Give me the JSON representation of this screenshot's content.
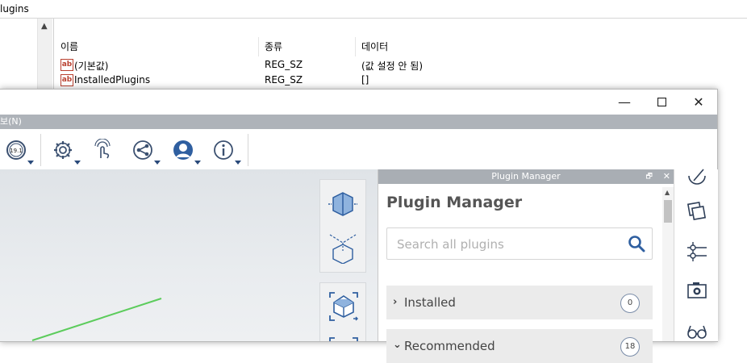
{
  "registry": {
    "address": "lugins",
    "columns": [
      "이름",
      "종류",
      "데이터"
    ],
    "rows": [
      {
        "name": "(기본값)",
        "type": "REG_SZ",
        "data": "(값 설정 안 됨)"
      },
      {
        "name": "InstalledPlugins",
        "type": "REG_SZ",
        "data": "[]"
      }
    ],
    "value_icon": "ab"
  },
  "app": {
    "window_buttons": {
      "minimize": "—",
      "maximize": "☐",
      "close": "✕"
    },
    "menu": {
      "partial_item": "보(N)"
    },
    "toolbar_icons": [
      "version-badge-icon",
      "settings-icon",
      "touch-hand-icon",
      "share-icon",
      "account-icon",
      "info-icon"
    ],
    "version_badge": "19.1"
  },
  "plugin_manager": {
    "panel_title": "Plugin Manager",
    "heading": "Plugin Manager",
    "search": {
      "placeholder": "Search all plugins",
      "value": ""
    },
    "sections": [
      {
        "label": "Installed",
        "count": "0",
        "expanded": false
      },
      {
        "label": "Recommended",
        "count": "18",
        "expanded": true
      }
    ],
    "header_buttons": {
      "float": "🗗",
      "close": "✕"
    }
  },
  "right_strip_icons": [
    "sketch-icon",
    "layers-icon",
    "align-icon",
    "camera-icon",
    "glasses-icon"
  ],
  "colors": {
    "accent": "#2f5fa0",
    "icon": "#3b5070",
    "menubar": "#aeb3b9",
    "panel_header": "#a9aeb4"
  }
}
